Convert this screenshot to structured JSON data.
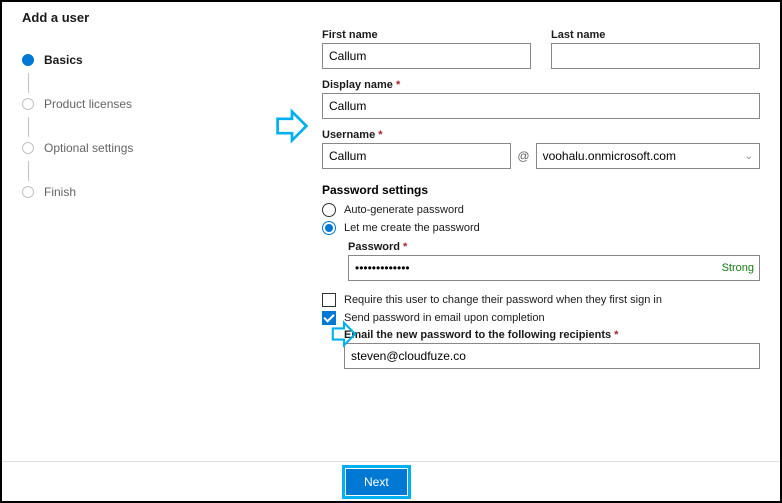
{
  "header": {
    "title": "Add a user"
  },
  "steps": {
    "s1": "Basics",
    "s2": "Product licenses",
    "s3": "Optional settings",
    "s4": "Finish"
  },
  "form": {
    "first_name_label": "First name",
    "first_name_value": "Callum",
    "last_name_label": "Last name",
    "last_name_value": "",
    "display_name_label": "Display name",
    "display_name_value": "Callum",
    "username_label": "Username",
    "username_value": "Callum",
    "at": "@",
    "domain_value": "voohalu.onmicrosoft.com",
    "password_settings_title": "Password settings",
    "radio_auto": "Auto-generate password",
    "radio_manual": "Let me create the password",
    "password_label": "Password",
    "password_value": "•••••••••••••",
    "password_strength": "Strong",
    "check_require_change": "Require this user to change their password when they first sign in",
    "check_send_email": "Send password in email upon completion",
    "email_recipients_label": "Email the new password to the following recipients",
    "email_recipients_value": "steven@cloudfuze.co",
    "required_mark": "*"
  },
  "footer": {
    "next_label": "Next"
  },
  "icons": {
    "arrow_color": "#00b0f0"
  }
}
